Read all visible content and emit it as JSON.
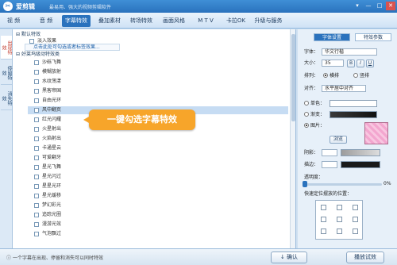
{
  "app": {
    "title": "爱剪辑",
    "slogan": "最易用、强大的视频剪辑软件"
  },
  "window_controls": [
    "▾",
    "—",
    "□",
    "✕"
  ],
  "menu": {
    "tabs": [
      "视 频",
      "音 频",
      "字幕特效",
      "叠加素材",
      "转场特效",
      "画面风格",
      "M T V",
      "卡拉OK",
      "升级与服务"
    ],
    "active": "字幕特效"
  },
  "side_tabs": [
    "出现特效",
    "停留特效",
    "消失特效"
  ],
  "tree": {
    "default_group": "默认特效",
    "default_item": "淡入效果",
    "group": "好莱坞级动特效类",
    "tip": "点击此处可勾选或者标签效果...",
    "items": [
      "沙砾飞舞",
      "模糊放射",
      "水纹荡漾",
      "黑客帝国",
      "自由光环",
      "风中翻页",
      "红光闪耀",
      "火星射出",
      "火焰射出",
      "卡通星云",
      "可爱翻牙",
      "星光飞舞",
      "星光闪过",
      "星星光环",
      "星光缓移",
      "梦幻彩光",
      "追踪光圈",
      "漫游光效",
      "气泡飘过"
    ],
    "selected": "风中翻页"
  },
  "callout": "一键勾选字幕特效",
  "right_panel": {
    "tabs": [
      "字体设置",
      "特效参数"
    ],
    "active_tab": "字体设置",
    "font_label": "字体：",
    "font_value": "华文行楷",
    "size_label": "大小：",
    "size_value": "35",
    "layout_label": "排列：",
    "layout_options": [
      "横排",
      "竖排"
    ],
    "align_label": "对齐：",
    "align_value": "水平居中对齐",
    "single_color_label": "单色：",
    "gradient_label": "渐变：",
    "image_label": "图片：",
    "browse_label": "浏览",
    "shadow_label": "阴影：",
    "stroke_label": "描边：",
    "opacity_label": "透明度：",
    "opacity_value": "0%",
    "opacity_fraction": 0,
    "position_label": "快速定位摆放的位置："
  },
  "colors": {
    "single": "#ffffff",
    "gradient": "#3a3a3a",
    "shadow_start": "#9c9c9c",
    "stroke": "#1a1a1a",
    "accent": "#2a72bd",
    "callout": "#f7a52a"
  },
  "status": {
    "text": "一个字幕在出现、停留和消失可以同时特效"
  },
  "buttons": {
    "apply": "确认",
    "play": "播放试效"
  }
}
